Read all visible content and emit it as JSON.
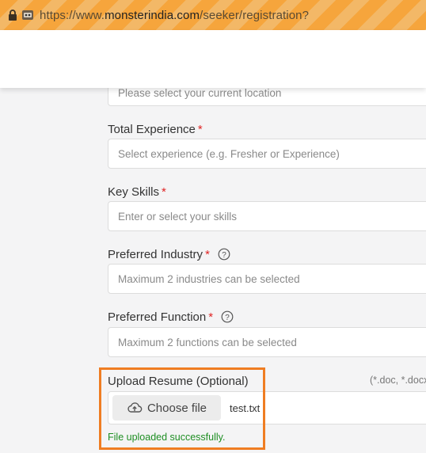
{
  "browser": {
    "url_prefix": "https://www.",
    "url_host": "monsterindia.com",
    "url_path": "/seeker/registration?"
  },
  "form": {
    "location_placeholder": "Please select your current location",
    "total_experience": {
      "label": "Total Experience",
      "required_mark": "*",
      "placeholder": "Select experience (e.g. Fresher or Experience)"
    },
    "key_skills": {
      "label": "Key Skills",
      "required_mark": "*",
      "placeholder": "Enter or select your skills"
    },
    "preferred_industry": {
      "label": "Preferred Industry",
      "required_mark": "*",
      "placeholder": "Maximum 2 industries can be selected"
    },
    "preferred_function": {
      "label": "Preferred Function",
      "required_mark": "*",
      "placeholder": "Maximum 2 functions can be selected"
    },
    "upload_resume": {
      "label": "Upload Resume (Optional)",
      "file_types_hint": "(*.doc, *.docx",
      "choose_button_label": "Choose file",
      "file_name": "test.txt",
      "status_message": "File uploaded successfully."
    }
  },
  "colors": {
    "required": "#e02424",
    "success": "#1e8e23",
    "highlight_outline": "#ef7d22",
    "url_bar": "#f6a53c"
  },
  "icons": [
    "lock-icon",
    "robot-icon",
    "help-icon",
    "cloud-upload-icon"
  ]
}
